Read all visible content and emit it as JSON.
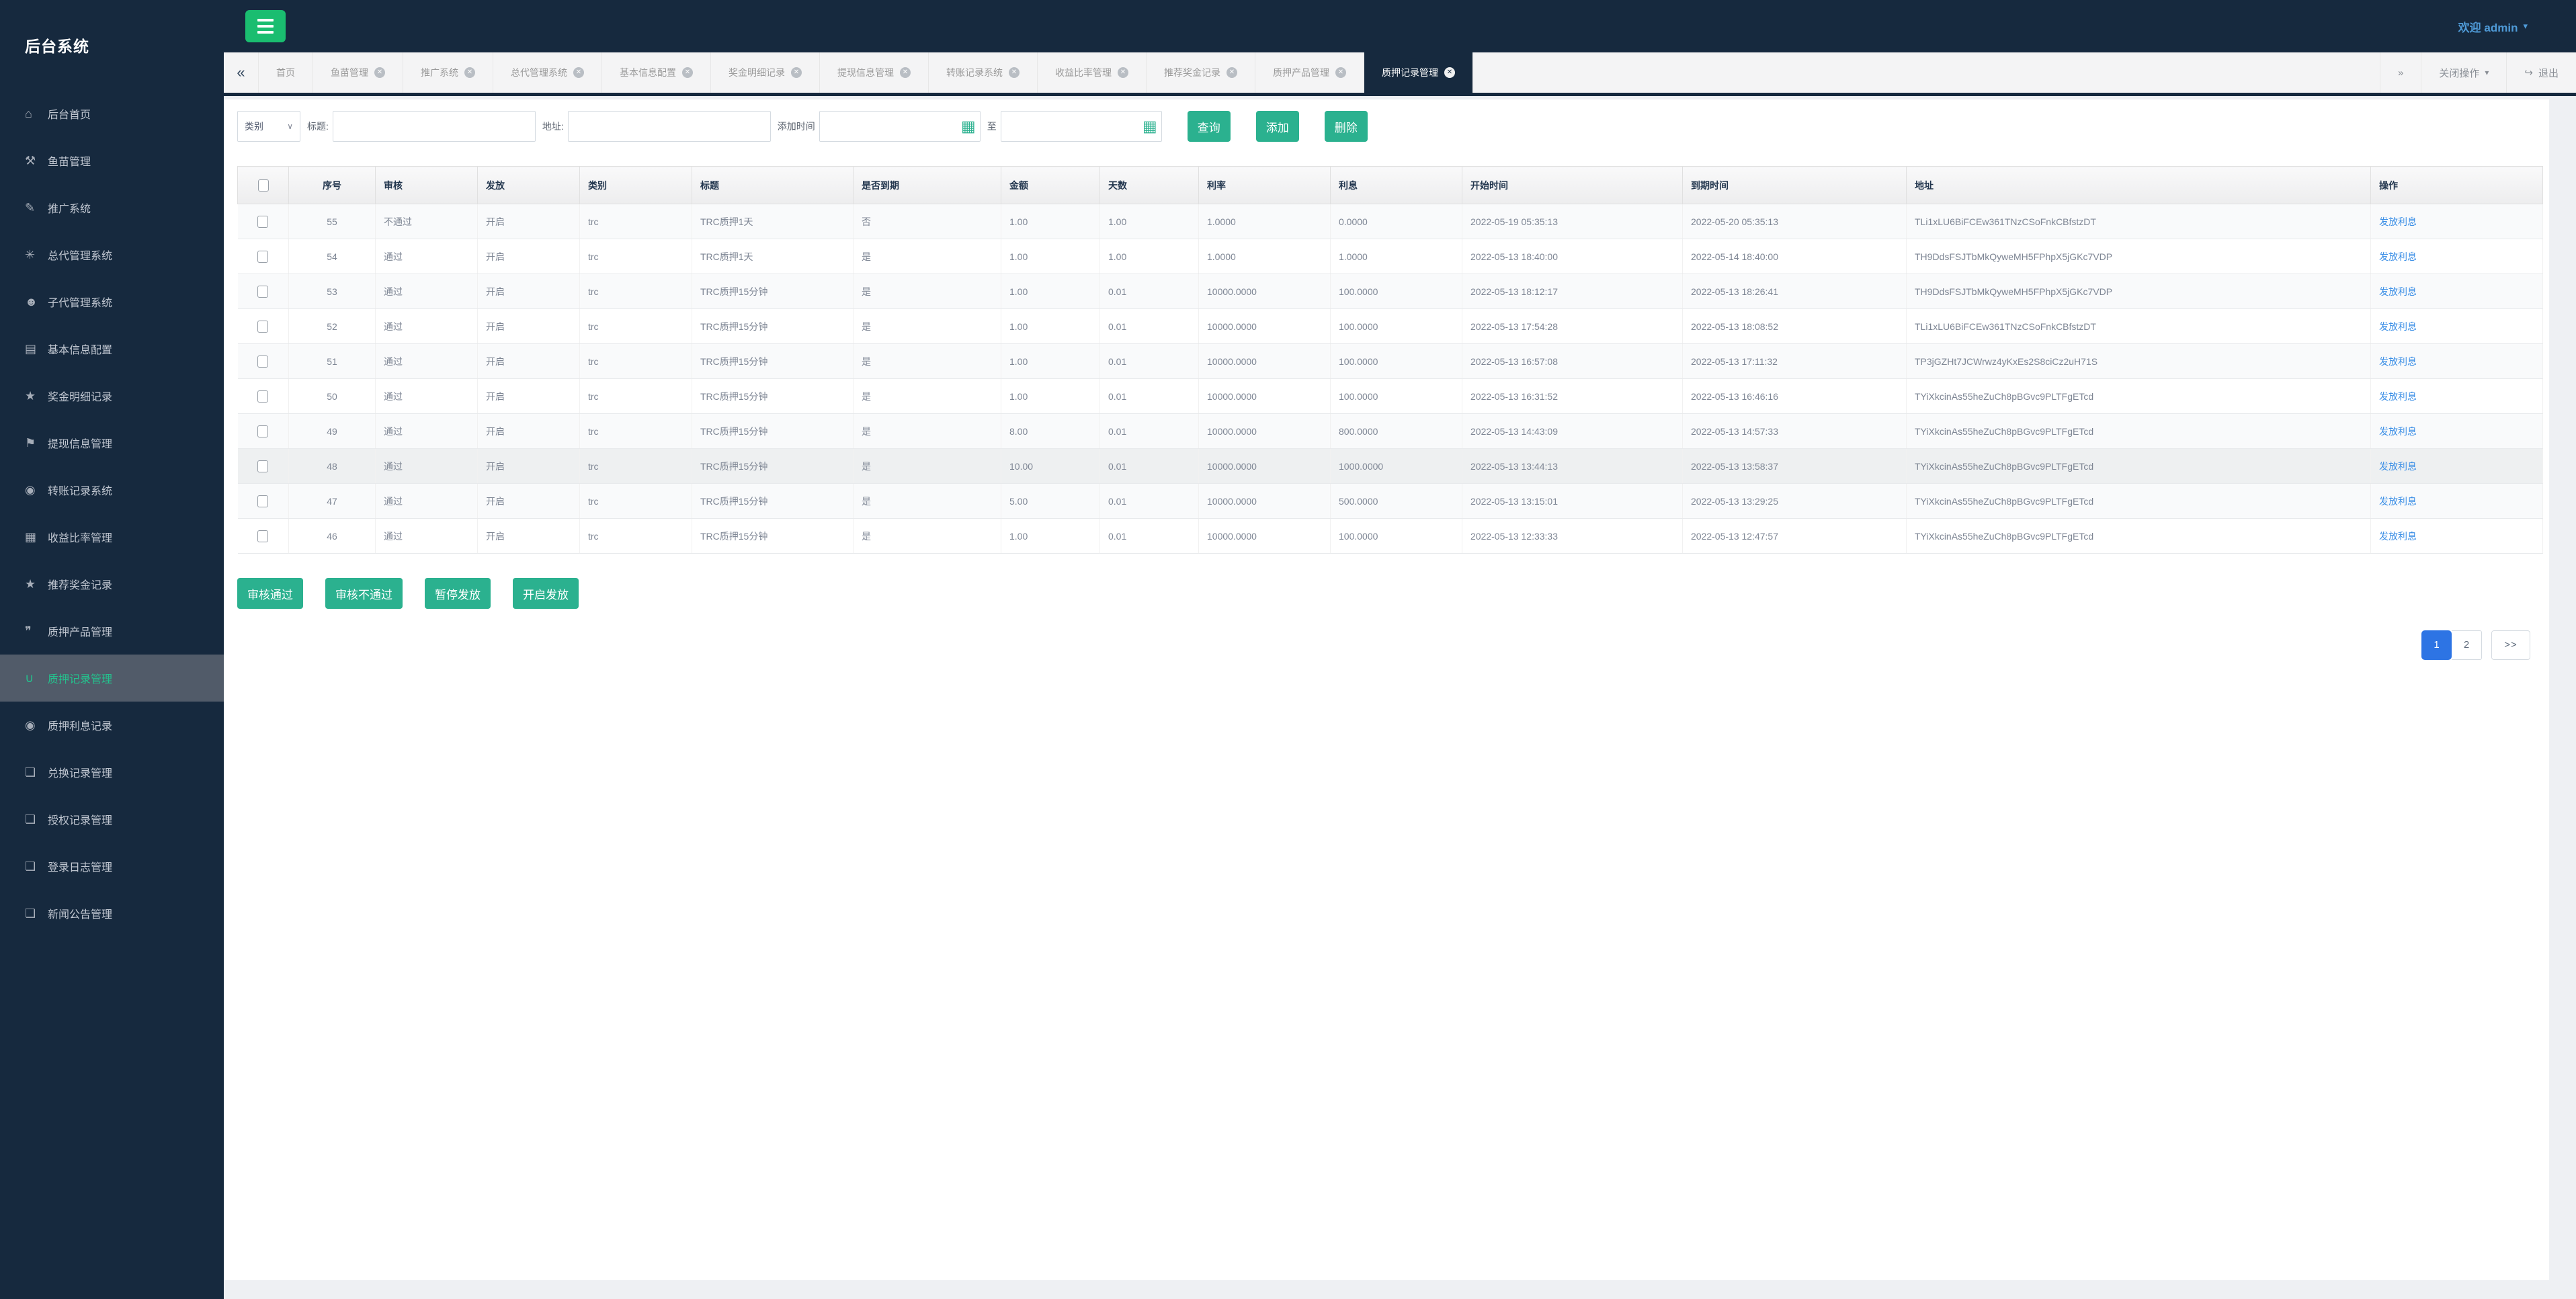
{
  "app": {
    "logo": "后台系统",
    "welcome": "欢迎 admin",
    "colors": {
      "navy": "#16293e",
      "teal": "#2bb18f",
      "hamburger_green": "#1abd70",
      "pagination_blue": "#2d74e4",
      "link_blue": "#3a8ee6",
      "sidebar_active_bg": "#515b69",
      "sidebar_active_text": "#23c48e"
    }
  },
  "sidebar": {
    "items": [
      {
        "icon": "home-icon",
        "glyph": "⌂",
        "label": "后台首页",
        "active": false
      },
      {
        "icon": "wrench-icon",
        "glyph": "⚒",
        "label": "鱼苗管理",
        "active": false
      },
      {
        "icon": "edit-icon",
        "glyph": "✎",
        "label": "推广系统",
        "active": false
      },
      {
        "icon": "asterisk-icon",
        "glyph": "✳",
        "label": "总代管理系统",
        "active": false
      },
      {
        "icon": "users-icon",
        "glyph": "☻",
        "label": "子代管理系统",
        "active": false
      },
      {
        "icon": "file-icon",
        "glyph": "▤",
        "label": "基本信息配置",
        "active": false
      },
      {
        "icon": "star-icon",
        "glyph": "★",
        "label": "奖金明细记录",
        "active": false
      },
      {
        "icon": "tag-icon",
        "glyph": "⚑",
        "label": "提现信息管理",
        "active": false
      },
      {
        "icon": "power-icon",
        "glyph": "◉",
        "label": "转账记录系统",
        "active": false
      },
      {
        "icon": "calendar-icon",
        "glyph": "▦",
        "label": "收益比率管理",
        "active": false
      },
      {
        "icon": "star-icon",
        "glyph": "★",
        "label": "推荐奖金记录",
        "active": false
      },
      {
        "icon": "comment-icon",
        "glyph": "❞",
        "label": "质押产品管理",
        "active": false
      },
      {
        "icon": "magnet-icon",
        "glyph": "∪",
        "label": "质押记录管理",
        "active": true
      },
      {
        "icon": "power-icon",
        "glyph": "◉",
        "label": "质押利息记录",
        "active": false
      },
      {
        "icon": "book-icon",
        "glyph": "❏",
        "label": "兑换记录管理",
        "active": false
      },
      {
        "icon": "book-icon",
        "glyph": "❏",
        "label": "授权记录管理",
        "active": false
      },
      {
        "icon": "book-icon",
        "glyph": "❏",
        "label": "登录日志管理",
        "active": false
      },
      {
        "icon": "book-icon",
        "glyph": "❏",
        "label": "新闻公告管理",
        "active": false
      }
    ]
  },
  "tabbar": {
    "scroll_left": "«",
    "scroll_right": "»",
    "tabs": [
      {
        "label": "首页",
        "closable": false,
        "active": false
      },
      {
        "label": "鱼苗管理",
        "closable": true,
        "active": false
      },
      {
        "label": "推广系统",
        "closable": true,
        "active": false
      },
      {
        "label": "总代管理系统",
        "closable": true,
        "active": false
      },
      {
        "label": "基本信息配置",
        "closable": true,
        "active": false
      },
      {
        "label": "奖金明细记录",
        "closable": true,
        "active": false
      },
      {
        "label": "提现信息管理",
        "closable": true,
        "active": false
      },
      {
        "label": "转账记录系统",
        "closable": true,
        "active": false
      },
      {
        "label": "收益比率管理",
        "closable": true,
        "active": false
      },
      {
        "label": "推荐奖金记录",
        "closable": true,
        "active": false
      },
      {
        "label": "质押产品管理",
        "closable": true,
        "active": false
      },
      {
        "label": "质押记录管理",
        "closable": true,
        "active": true
      }
    ],
    "close_glyph": "✕",
    "close_ops_label": "关闭操作",
    "caret": "▾",
    "logout_glyph": "↪",
    "logout_label": "退出"
  },
  "filters": {
    "category_label": "类别",
    "category_caret": "∨",
    "title_label": "标题:",
    "title_value": "",
    "address_label": "地址:",
    "address_value": "",
    "time_label": "添加时间",
    "time_from_value": "",
    "to_label": "至",
    "time_to_value": "",
    "calendar_glyph": "▦",
    "search_button": "查询",
    "add_button": "添加",
    "delete_button": "删除"
  },
  "table": {
    "headers": [
      "序号",
      "审核",
      "发放",
      "类别",
      "标题",
      "是否到期",
      "金额",
      "天数",
      "利率",
      "利息",
      "开始时间",
      "到期时间",
      "地址",
      "操作"
    ],
    "action_label": "发放利息",
    "rows": [
      {
        "hovered": false,
        "cells": [
          "55",
          "不通过",
          "开启",
          "trc",
          "TRC质押1天",
          "否",
          "1.00",
          "1.00",
          "1.0000",
          "0.0000",
          "2022-05-19 05:35:13",
          "2022-05-20 05:35:13",
          "TLi1xLU6BiFCEw361TNzCSoFnkCBfstzDT"
        ]
      },
      {
        "hovered": false,
        "cells": [
          "54",
          "通过",
          "开启",
          "trc",
          "TRC质押1天",
          "是",
          "1.00",
          "1.00",
          "1.0000",
          "1.0000",
          "2022-05-13 18:40:00",
          "2022-05-14 18:40:00",
          "TH9DdsFSJTbMkQyweMH5FPhpX5jGKc7VDP"
        ]
      },
      {
        "hovered": false,
        "cells": [
          "53",
          "通过",
          "开启",
          "trc",
          "TRC质押15分钟",
          "是",
          "1.00",
          "0.01",
          "10000.0000",
          "100.0000",
          "2022-05-13 18:12:17",
          "2022-05-13 18:26:41",
          "TH9DdsFSJTbMkQyweMH5FPhpX5jGKc7VDP"
        ]
      },
      {
        "hovered": false,
        "cells": [
          "52",
          "通过",
          "开启",
          "trc",
          "TRC质押15分钟",
          "是",
          "1.00",
          "0.01",
          "10000.0000",
          "100.0000",
          "2022-05-13 17:54:28",
          "2022-05-13 18:08:52",
          "TLi1xLU6BiFCEw361TNzCSoFnkCBfstzDT"
        ]
      },
      {
        "hovered": false,
        "cells": [
          "51",
          "通过",
          "开启",
          "trc",
          "TRC质押15分钟",
          "是",
          "1.00",
          "0.01",
          "10000.0000",
          "100.0000",
          "2022-05-13 16:57:08",
          "2022-05-13 17:11:32",
          "TP3jGZHt7JCWrwz4yKxEs2S8ciCz2uH71S"
        ]
      },
      {
        "hovered": false,
        "cells": [
          "50",
          "通过",
          "开启",
          "trc",
          "TRC质押15分钟",
          "是",
          "1.00",
          "0.01",
          "10000.0000",
          "100.0000",
          "2022-05-13 16:31:52",
          "2022-05-13 16:46:16",
          "TYiXkcinAs55heZuCh8pBGvc9PLTFgETcd"
        ]
      },
      {
        "hovered": false,
        "cells": [
          "49",
          "通过",
          "开启",
          "trc",
          "TRC质押15分钟",
          "是",
          "8.00",
          "0.01",
          "10000.0000",
          "800.0000",
          "2022-05-13 14:43:09",
          "2022-05-13 14:57:33",
          "TYiXkcinAs55heZuCh8pBGvc9PLTFgETcd"
        ]
      },
      {
        "hovered": true,
        "cells": [
          "48",
          "通过",
          "开启",
          "trc",
          "TRC质押15分钟",
          "是",
          "10.00",
          "0.01",
          "10000.0000",
          "1000.0000",
          "2022-05-13 13:44:13",
          "2022-05-13 13:58:37",
          "TYiXkcinAs55heZuCh8pBGvc9PLTFgETcd"
        ]
      },
      {
        "hovered": false,
        "cells": [
          "47",
          "通过",
          "开启",
          "trc",
          "TRC质押15分钟",
          "是",
          "5.00",
          "0.01",
          "10000.0000",
          "500.0000",
          "2022-05-13 13:15:01",
          "2022-05-13 13:29:25",
          "TYiXkcinAs55heZuCh8pBGvc9PLTFgETcd"
        ]
      },
      {
        "hovered": false,
        "cells": [
          "46",
          "通过",
          "开启",
          "trc",
          "TRC质押15分钟",
          "是",
          "1.00",
          "0.01",
          "10000.0000",
          "100.0000",
          "2022-05-13 12:33:33",
          "2022-05-13 12:47:57",
          "TYiXkcinAs55heZuCh8pBGvc9PLTFgETcd"
        ]
      }
    ]
  },
  "batch_actions": [
    "审核通过",
    "审核不通过",
    "暂停发放",
    "开启发放"
  ],
  "pagination": {
    "pages": [
      "1",
      "2"
    ],
    "active_page": "1",
    "next_label": ">>"
  }
}
